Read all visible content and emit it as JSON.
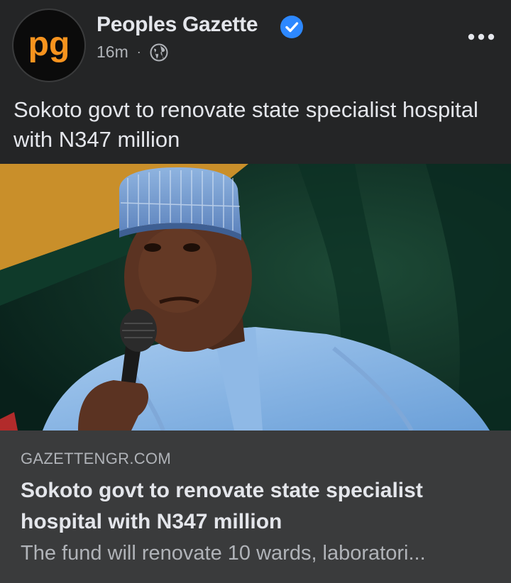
{
  "post": {
    "page_name": "Peoples Gazette",
    "time": "16m",
    "separator": "·",
    "avatar_logo_text": "pg",
    "text": "Sokoto govt to renovate state specialist hospital with N347 million"
  },
  "link_preview": {
    "domain": "GAZETTENGR.COM",
    "title": "Sokoto govt to renovate state specialist hospital with N347 million",
    "description": "The fund will renovate 10 wards, laboratori..."
  },
  "icons": {
    "verified": "verified-badge-icon",
    "audience": "globe-icon",
    "more": "more-options-icon"
  },
  "colors": {
    "background": "#242526",
    "card": "#3a3b3c",
    "text_primary": "#e4e6eb",
    "text_secondary": "#b0b3b8",
    "verified_blue": "#2d88ff",
    "logo_orange": "#f7931e"
  }
}
